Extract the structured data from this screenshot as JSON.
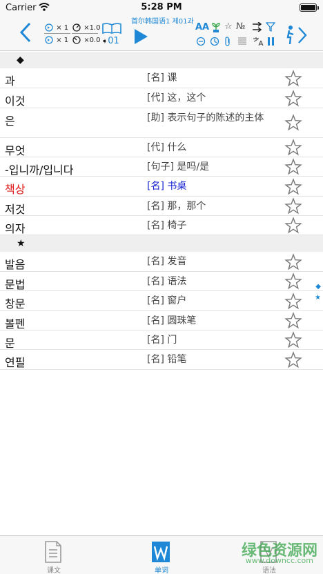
{
  "status_bar": {
    "carrier": "Carrier",
    "time": "5:28 PM"
  },
  "toolbar": {
    "lesson_title": "首尔韩国语1 제01과",
    "rate_1": "× 1",
    "rate_2": "×1.0",
    "rate_3": "× 1",
    "rate_4": "×0.0",
    "count": "01",
    "number_symbol": "№",
    "font_size_icon": "AA"
  },
  "sections": [
    {
      "symbol": "◆"
    },
    {
      "symbol": "★"
    }
  ],
  "words_1": [
    {
      "word": "과",
      "meaning": "[名] 课"
    },
    {
      "word": "이것",
      "meaning": "[代] 这，这个"
    },
    {
      "word": "은",
      "meaning": "[助] 表示句子的陈述的主体"
    },
    {
      "word": "무엇",
      "meaning": "[代] 什么"
    },
    {
      "word": "-입니까/입니다",
      "meaning": "[句子] 是吗/是"
    },
    {
      "word": "책상",
      "meaning": "[名] 书桌"
    },
    {
      "word": "저것",
      "meaning": "[名] 那，那个"
    },
    {
      "word": "의자",
      "meaning": "[名] 椅子"
    }
  ],
  "words_2": [
    {
      "word": "발음",
      "meaning": "[名] 发音"
    },
    {
      "word": "문법",
      "meaning": "[名] 语法"
    },
    {
      "word": "창문",
      "meaning": "[名] 窗户"
    },
    {
      "word": "볼펜",
      "meaning": "[名] 圆珠笔"
    },
    {
      "word": "문",
      "meaning": "[名] 门"
    },
    {
      "word": "연필",
      "meaning": "[名] 铅笔"
    }
  ],
  "side_index": [
    "◆",
    "★"
  ],
  "tabs": [
    {
      "label": "课文",
      "icon": "document-icon"
    },
    {
      "label": "单词",
      "icon": "w-icon"
    },
    {
      "label": "语法",
      "icon": "grammar-icon"
    }
  ],
  "watermark": {
    "text": "绿色资源网",
    "url": "www.downcc.com"
  },
  "colors": {
    "accent": "#1e88d6",
    "highlight_word": "#e0201e",
    "highlight_meaning": "#1420d0"
  }
}
